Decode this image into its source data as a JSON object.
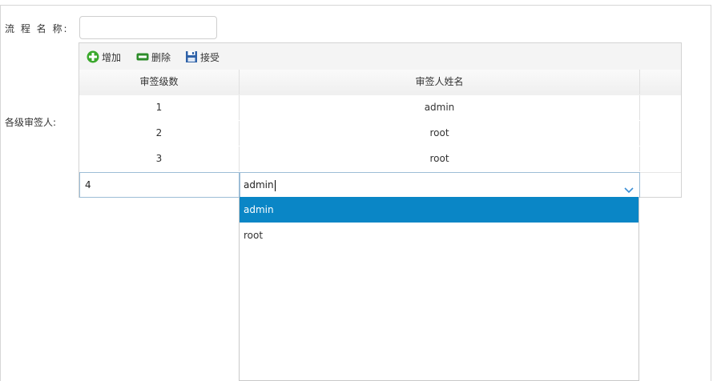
{
  "form": {
    "name_label": "流 程 名 称:",
    "name_value": "",
    "signers_label": "各级审签人:"
  },
  "toolbar": {
    "add_label": "增加",
    "delete_label": "删除",
    "accept_label": "接受"
  },
  "grid": {
    "headers": [
      "审签级数",
      "审签人姓名",
      ""
    ],
    "rows": [
      {
        "level": "1",
        "name": "admin"
      },
      {
        "level": "2",
        "name": "root"
      },
      {
        "level": "3",
        "name": "root"
      }
    ],
    "edit_row": {
      "level": "4",
      "name": "admin"
    }
  },
  "dropdown": {
    "options": [
      "admin",
      "root"
    ],
    "selected_index": 0
  },
  "colors": {
    "selected_option": "#0a86c6",
    "add_icon": "#3aa82c",
    "delete_icon": "#2d8c2a",
    "save_icon": "#2f62a8"
  }
}
